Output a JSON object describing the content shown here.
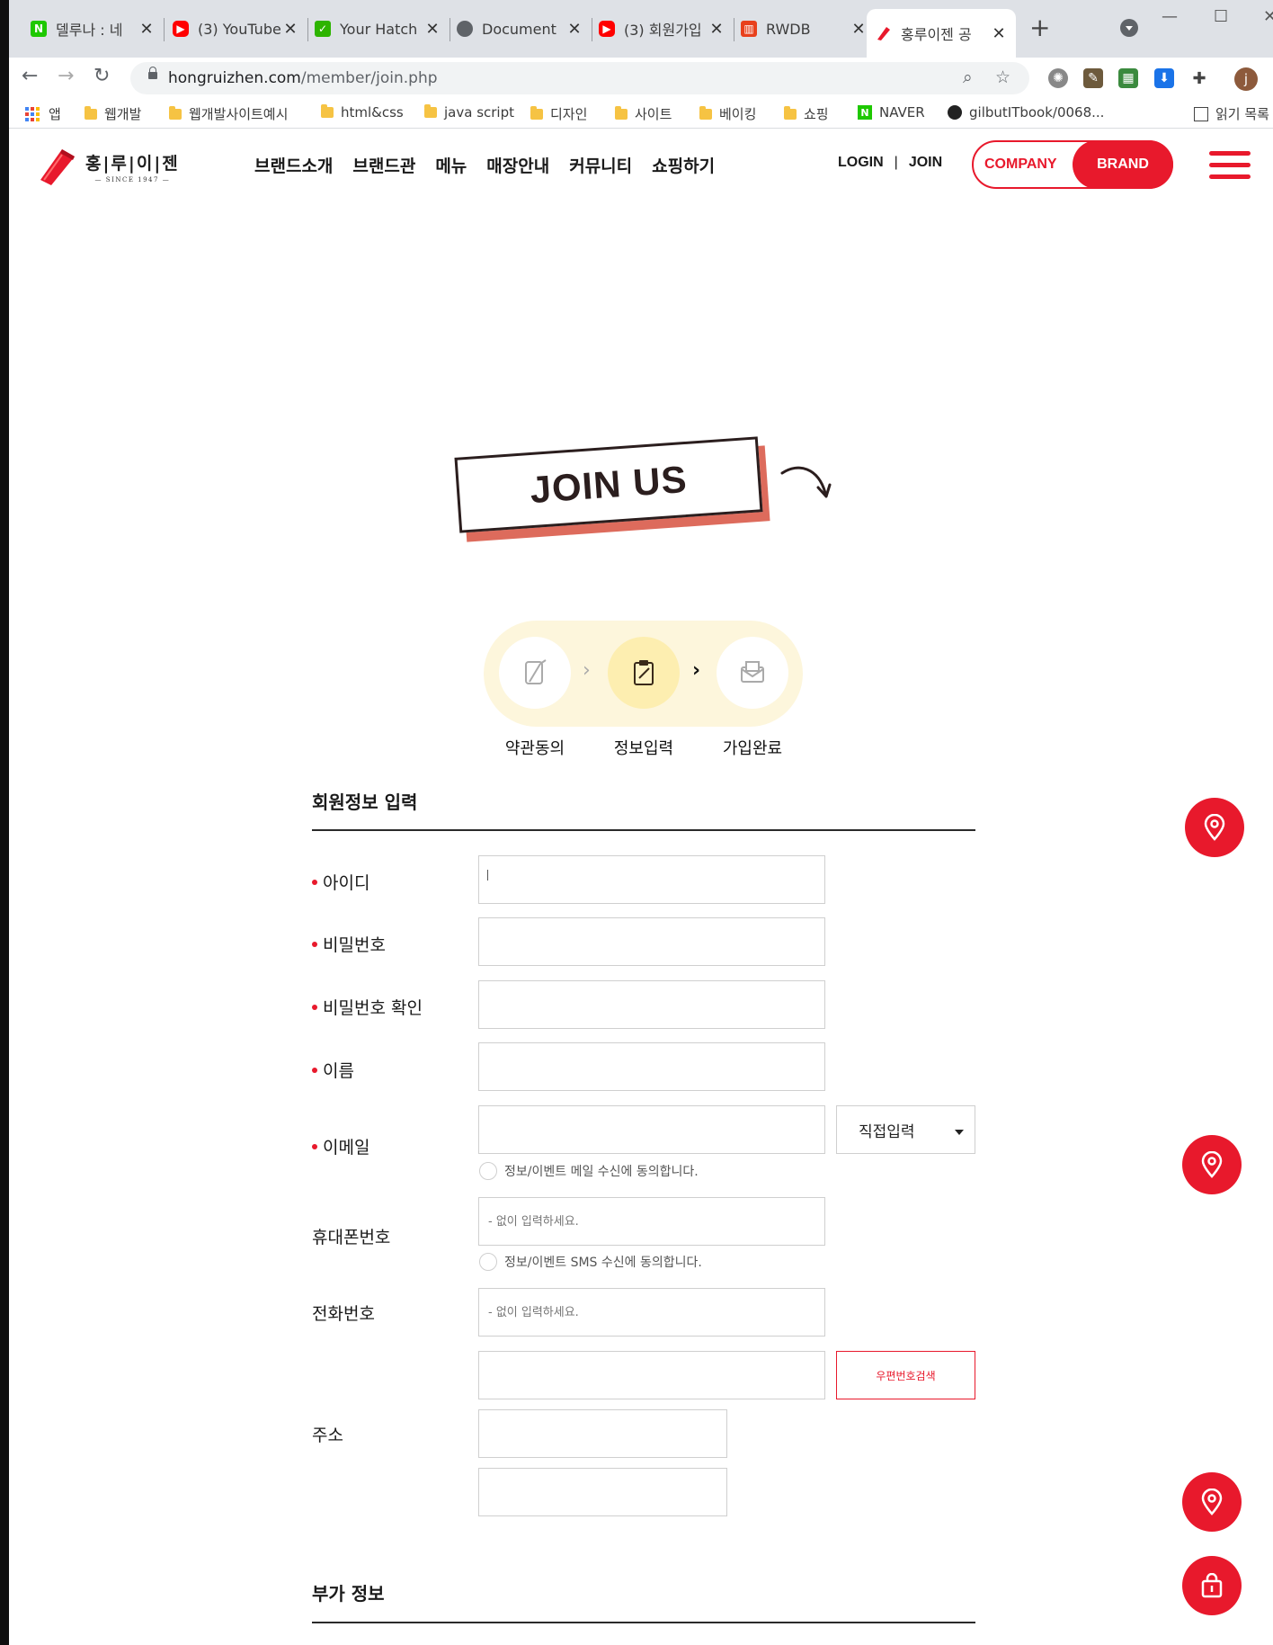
{
  "browser": {
    "tabs": [
      {
        "title": "델루나 : 네",
        "favicon": "naver-icon",
        "color": "#1ec800"
      },
      {
        "title": "(3) YouTube",
        "favicon": "youtube-icon",
        "color": "#ff0000"
      },
      {
        "title": "Your Hatch",
        "favicon": "hatch-icon",
        "color": "#2db400"
      },
      {
        "title": "Document",
        "favicon": "globe-icon",
        "color": "#5f6368"
      },
      {
        "title": "(3) 회원가입",
        "favicon": "youtube-icon",
        "color": "#ff0000"
      },
      {
        "title": "RWDB",
        "favicon": "rwdb-icon",
        "color": "#e8401c"
      },
      {
        "title": "홍루이젠 공",
        "favicon": "hongruizhen-icon",
        "color": "#e8192c"
      }
    ],
    "url_host": "hongruizhen.com",
    "url_path": "/member/join.php",
    "bookmarks": [
      "앱",
      "웹개발",
      "웹개발사이트예시",
      "html&css",
      "java script",
      "디자인",
      "사이트",
      "베이킹",
      "쇼핑",
      "NAVER",
      "gilbutITbook/0068...",
      "읽기 목록"
    ]
  },
  "header": {
    "logo_main": "홍|루|이|젠",
    "logo_sub": "— SINCE 1947 —",
    "nav": [
      "브랜드소개",
      "브랜드관",
      "메뉴",
      "매장안내",
      "커뮤니티",
      "쇼핑하기"
    ],
    "login": "LOGIN",
    "separator": "|",
    "join": "JOIN",
    "company": "COMPANY",
    "brand": "BRAND",
    "accent_color": "#e8192c"
  },
  "banner": {
    "title": "JOIN US"
  },
  "steps": {
    "items": [
      "약관동의",
      "정보입력",
      "가입완료"
    ],
    "current": 2
  },
  "form": {
    "section1_title": "회원정보 입력",
    "section2_title": "부가 정보",
    "labels": {
      "id": "아이디",
      "password": "비밀번호",
      "password_confirm": "비밀번호 확인",
      "name": "이름",
      "email": "이메일",
      "mobile": "휴대폰번호",
      "phone": "전화번호",
      "address": "주소"
    },
    "email_domain_select": "직접입력",
    "email_agree": "정보/이벤트 메일 수신에 동의합니다.",
    "sms_agree": "정보/이벤트 SMS 수신에 동의합니다.",
    "mobile_placeholder": "- 없이 입력하세요.",
    "phone_placeholder": "- 없이 입력하세요.",
    "zip_search_button": "우편번호검색"
  }
}
